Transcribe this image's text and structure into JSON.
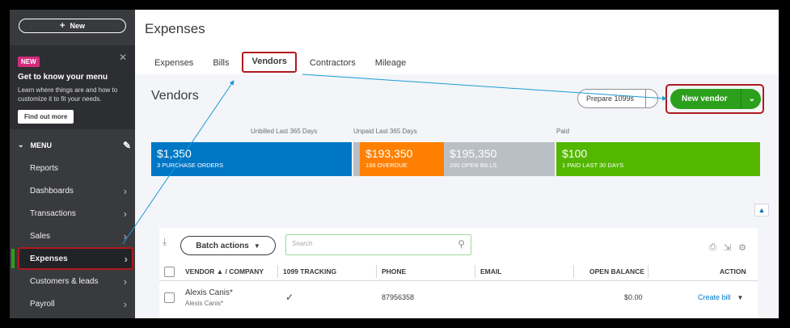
{
  "sidebar": {
    "new_label": "New",
    "promo": {
      "badge": "NEW",
      "title": "Get to know your menu",
      "text": "Learn where things are and how to customize it to fit your needs.",
      "button": "Find out more"
    },
    "menu_label": "MENU",
    "items": [
      {
        "label": "Reports"
      },
      {
        "label": "Dashboards"
      },
      {
        "label": "Transactions"
      },
      {
        "label": "Sales"
      },
      {
        "label": "Expenses"
      },
      {
        "label": "Customers & leads"
      },
      {
        "label": "Payroll"
      }
    ]
  },
  "header": {
    "title": "Expenses",
    "tabs": [
      {
        "label": "Expenses"
      },
      {
        "label": "Bills"
      },
      {
        "label": "Vendors"
      },
      {
        "label": "Contractors"
      },
      {
        "label": "Mileage"
      }
    ]
  },
  "vendors": {
    "title": "Vendors",
    "prepare_label": "Prepare 1099s",
    "new_vendor_label": "New vendor"
  },
  "money_bar": {
    "unbilled_label": "Unbilled Last 365 Days",
    "unpaid_label": "Unpaid Last 365 Days",
    "paid_label": "Paid",
    "segments": [
      {
        "amount": "$1,350",
        "caption": "3 PURCHASE ORDERS",
        "color": "#0077c5"
      },
      {
        "amount": "$193,350",
        "caption": "198 OVERDUE",
        "color": "#ff8000"
      },
      {
        "amount": "$195,350",
        "caption": "200 OPEN BILLS",
        "color": "#babec5"
      },
      {
        "amount": "$100",
        "caption": "1 PAID LAST 30 DAYS",
        "color": "#53b700"
      }
    ]
  },
  "table": {
    "batch_label": "Batch actions",
    "search_placeholder": "Search",
    "columns": {
      "vendor": "VENDOR ▲ / COMPANY",
      "tracking": "1099 TRACKING",
      "phone": "PHONE",
      "email": "EMAIL",
      "balance": "OPEN BALANCE",
      "action": "ACTION"
    },
    "rows": [
      {
        "vendor": "Alexis Canis*",
        "company": "Alexis Canis*",
        "tracking": "✓",
        "phone": "87956358",
        "email": "",
        "balance": "$0.00",
        "action": "Create bill"
      }
    ]
  }
}
